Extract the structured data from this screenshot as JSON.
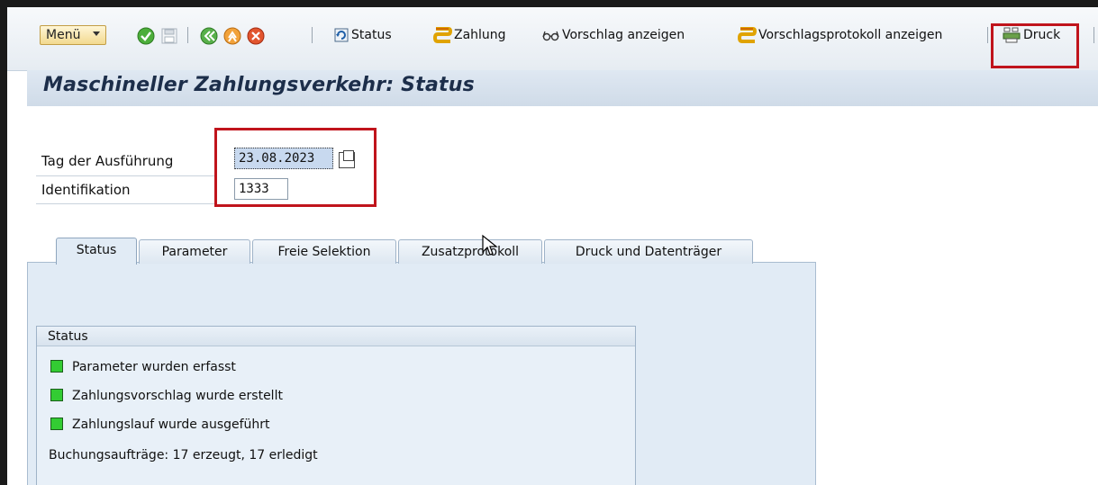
{
  "toolbar": {
    "menu_label": "Menü",
    "status_label": "Status",
    "zahlung_label": "Zahlung",
    "vorschlag_anzeigen_label": "Vorschlag anzeigen",
    "vorschlagsprotokoll_label": "Vorschlagsprotokoll anzeigen",
    "druck_label": "Druck"
  },
  "page": {
    "title": "Maschineller Zahlungsverkehr: Status"
  },
  "form": {
    "tag_label": "Tag der Ausführung",
    "tag_value": "23.08.2023",
    "identifikation_label": "Identifikation",
    "identifikation_value": "1333"
  },
  "tabs": [
    {
      "label": "Status",
      "active": true
    },
    {
      "label": "Parameter"
    },
    {
      "label": "Freie Selektion"
    },
    {
      "label": "Zusatzprotokoll"
    },
    {
      "label": "Druck und Datenträger"
    }
  ],
  "status_group": {
    "title": "Status",
    "items": [
      {
        "text": "Parameter wurden erfasst",
        "color": "#33cc33"
      },
      {
        "text": "Zahlungsvorschlag wurde erstellt",
        "color": "#33cc33"
      },
      {
        "text": "Zahlungslauf wurde ausgeführt",
        "color": "#33cc33"
      }
    ],
    "summary": "Buchungsaufträge: 17 erzeugt, 17 erledigt"
  },
  "colors": {
    "highlight_box": "#c0141c",
    "title_text": "#1c2e4a",
    "tab_panel": "#e1ebf5"
  },
  "icons": [
    "check-icon",
    "save-icon",
    "back-icon",
    "exit-icon",
    "cancel-icon",
    "refresh-icon",
    "zahlung-icon",
    "glasses-icon",
    "protocol-icon",
    "print-icon",
    "copy-icon"
  ]
}
